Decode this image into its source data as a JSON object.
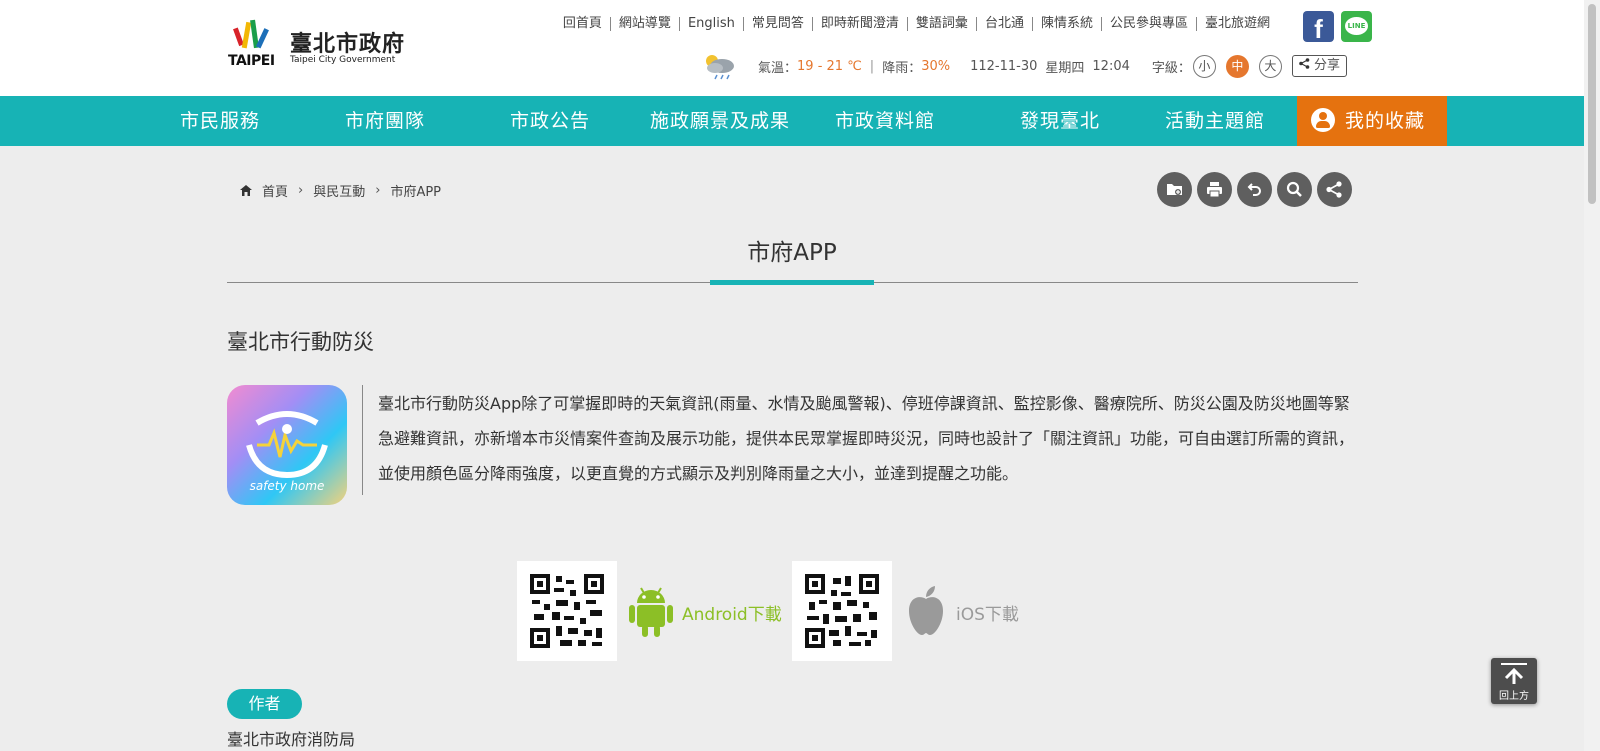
{
  "header": {
    "logo_zh": "臺北市政府",
    "logo_en": "Taipei City Government",
    "logo_taipei": "TAIPEI",
    "top_links": [
      "回首頁",
      "網站導覽",
      "English",
      "常見問答",
      "即時新聞澄清",
      "雙語詞彙",
      "台北通",
      "陳情系統",
      "公民參與專區",
      "臺北旅遊網"
    ],
    "social": {
      "facebook": "f",
      "line": "LINE"
    },
    "weather": {
      "temp_label": "氣溫：",
      "temp_value": "19 - 21 ℃",
      "rain_label": "降雨：",
      "rain_value": "30%",
      "date": "112-11-30",
      "weekday": "星期四",
      "time": "12:04"
    },
    "font_size": {
      "label": "字級：",
      "small": "小",
      "medium": "中",
      "large": "大"
    },
    "share_label": "分享"
  },
  "nav": {
    "items": [
      "市民服務",
      "市府團隊",
      "市政公告",
      "施政願景及成果",
      "市政資料館",
      "發現臺北",
      "活動主題館"
    ],
    "favorites": "我的收藏"
  },
  "breadcrumb": [
    "首頁",
    "與民互動",
    "市府APP"
  ],
  "page_title": "市府APP",
  "app": {
    "name": "臺北市行動防災",
    "icon_label": "safety home",
    "description": "臺北市行動防災App除了可掌握即時的天氣資訊(雨量、水情及颱風警報)、停班停課資訊、監控影像、醫療院所、防災公園及防災地圖等緊急避難資訊，亦新增本市災情案件查詢及展示功能，提供本民眾掌握即時災況，同時也設計了「關注資訊」功能，可自由選訂所需的資訊，並使用顏色區分降雨強度，以更直覺的方式顯示及判別降雨量之大小，並達到提醒之功能。",
    "android_label": "Android下載",
    "ios_label": "iOS下載",
    "android_color": "#8cbf26",
    "ios_color": "#9a9a9a"
  },
  "author": {
    "badge": "作者",
    "name": "臺北市政府消防局"
  },
  "to_top_label": "回上方",
  "colors": {
    "teal": "#17b3b5",
    "orange": "#e5720f"
  }
}
